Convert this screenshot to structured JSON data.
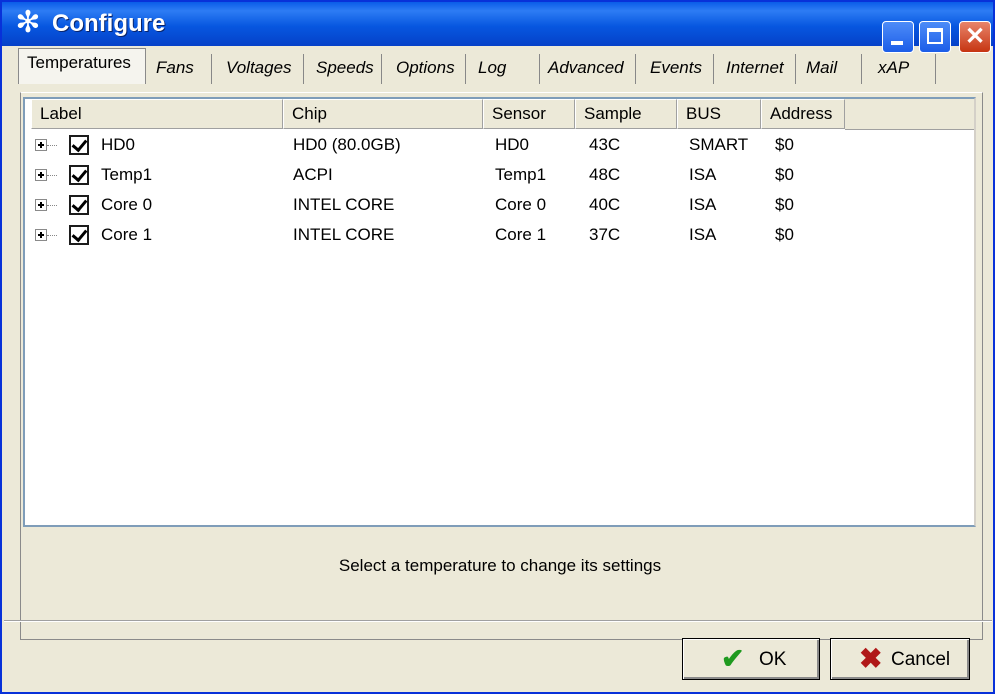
{
  "window": {
    "title": "Configure",
    "icon": "fan-icon"
  },
  "tabs": [
    "Temperatures",
    "Fans",
    "Voltages",
    "Speeds",
    "Options",
    "Log",
    "Advanced",
    "Events",
    "Internet",
    "Mail",
    "xAP"
  ],
  "columns": [
    "Label",
    "Chip",
    "Sensor",
    "Sample",
    "BUS",
    "Address"
  ],
  "rows": [
    {
      "label": "HD0",
      "chip": "HD0 (80.0GB)",
      "sensor": "HD0",
      "sample": "43C",
      "bus": "SMART",
      "address": "$0",
      "checked": true
    },
    {
      "label": "Temp1",
      "chip": "ACPI",
      "sensor": "Temp1",
      "sample": "48C",
      "bus": "ISA",
      "address": "$0",
      "checked": true
    },
    {
      "label": "Core 0",
      "chip": "INTEL CORE",
      "sensor": "Core 0",
      "sample": "40C",
      "bus": "ISA",
      "address": "$0",
      "checked": true
    },
    {
      "label": "Core 1",
      "chip": "INTEL CORE",
      "sensor": "Core 1",
      "sample": "37C",
      "bus": "ISA",
      "address": "$0",
      "checked": true
    }
  ],
  "status_text": "Select a temperature to change its settings",
  "buttons": {
    "ok": "OK",
    "cancel": "Cancel"
  },
  "colors": {
    "titlebar": "#0a5ce8",
    "ok_check": "#1f9a1f",
    "cancel_x": "#b01818"
  }
}
